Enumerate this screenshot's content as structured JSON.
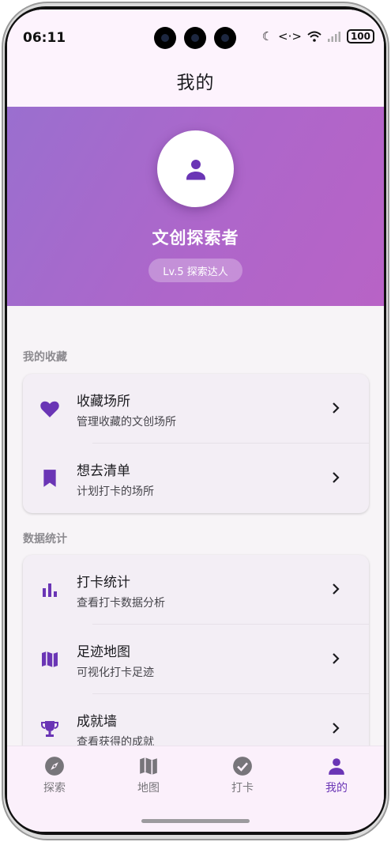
{
  "status_bar": {
    "time": "06:11",
    "battery": "100"
  },
  "header": {
    "title": "我的"
  },
  "profile": {
    "name": "文创探索者",
    "level": "Lv.5 探索达人",
    "accent_gradient": [
      "#9a6fcf",
      "#b863c6"
    ]
  },
  "sections": [
    {
      "title": "我的收藏",
      "items": [
        {
          "icon": "heart-icon",
          "title": "收藏场所",
          "subtitle": "管理收藏的文创场所"
        },
        {
          "icon": "bookmark-icon",
          "title": "想去清单",
          "subtitle": "计划打卡的场所"
        }
      ]
    },
    {
      "title": "数据统计",
      "items": [
        {
          "icon": "bar-chart-icon",
          "title": "打卡统计",
          "subtitle": "查看打卡数据分析"
        },
        {
          "icon": "map-icon",
          "title": "足迹地图",
          "subtitle": "可视化打卡足迹"
        },
        {
          "icon": "trophy-icon",
          "title": "成就墙",
          "subtitle": "查看获得的成就"
        }
      ]
    }
  ],
  "bottom_nav": [
    {
      "icon": "compass-icon",
      "label": "探索",
      "active": false
    },
    {
      "icon": "map-icon",
      "label": "地图",
      "active": false
    },
    {
      "icon": "check-circle-icon",
      "label": "打卡",
      "active": false
    },
    {
      "icon": "person-icon",
      "label": "我的",
      "active": true
    }
  ],
  "colors": {
    "accent": "#6a35b5",
    "inactive": "#77757a",
    "background": "#fdf6fd"
  }
}
